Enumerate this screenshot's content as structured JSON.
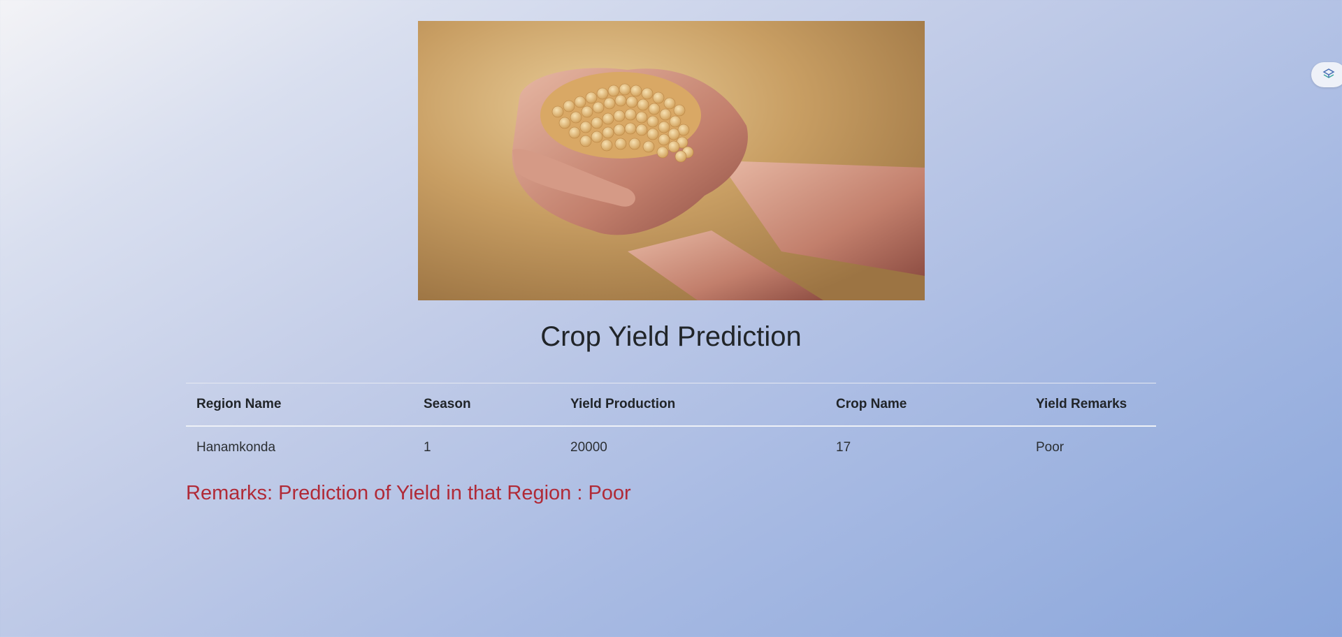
{
  "page": {
    "title": "Crop Yield Prediction",
    "hero_image": "hands-holding-soybeans-photo"
  },
  "table": {
    "headers": [
      "Region Name",
      "Season",
      "Yield Production",
      "Crop Name",
      "Yield Remarks"
    ],
    "rows": [
      [
        "Hanamkonda",
        "1",
        "20000",
        "17",
        "Poor"
      ]
    ]
  },
  "remarks": "Remarks: Prediction of Yield in that Region : Poor",
  "extension": {
    "icon": "extension-icon"
  },
  "colors": {
    "remarks_text": "#b02a37",
    "heading_text": "#212529"
  }
}
